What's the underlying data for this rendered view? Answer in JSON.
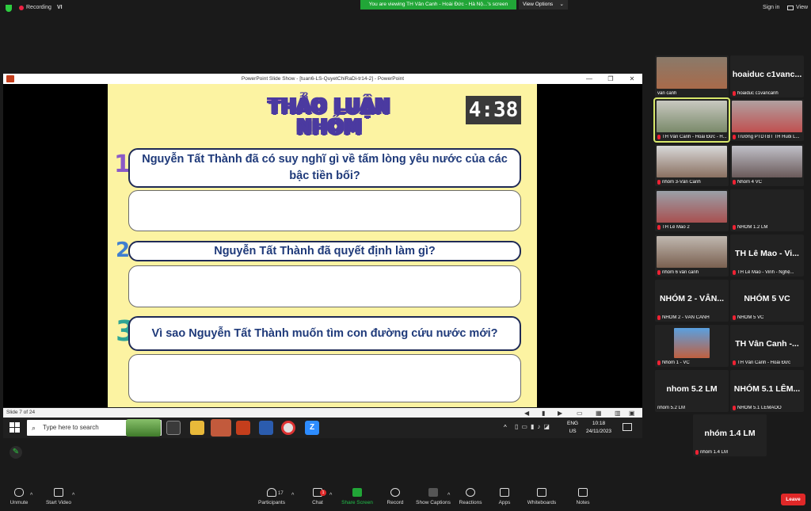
{
  "topbar": {
    "recording_label": "Recording",
    "language": "VI",
    "banner": "You are viewing TH Vân Canh - Hoài Đức - Hà Nộ...'s screen",
    "view_options": "View Options",
    "sign_in": "Sign in",
    "view": "View"
  },
  "ppt": {
    "window_title": "PowerPoint Slide Show - [tuan6-LS-QuyetChiRaDi-tr14-2] - PowerPoint",
    "status": "Slide 7 of 24",
    "slide": {
      "title": "THẢO LUẬN NHÓM",
      "timer": "4:38",
      "questions": [
        {
          "num": "1",
          "text": "Nguyễn Tất Thành đã có suy nghĩ gì về tấm lòng yêu nước của các bậc tiền bối?"
        },
        {
          "num": "2",
          "text": "Nguyễn Tất Thành đã quyết định làm gì?"
        },
        {
          "num": "3",
          "text": "Vì sao Nguyễn Tất Thành muốn tìm con đường cứu nước mới?"
        }
      ]
    }
  },
  "taskbar": {
    "search_placeholder": "Type here to search",
    "lang_line1": "ENG",
    "lang_line2": "US",
    "time": "10:18",
    "date": "24/11/2023"
  },
  "participants": [
    {
      "label": "van canh",
      "big": "",
      "has_video": true
    },
    {
      "label": "hoaiduc c1vancanh",
      "big": "hoaiduc c1vanc...",
      "has_video": false
    },
    {
      "label": "TH Vân Canh - Hoài Đức - H...",
      "big": "",
      "has_video": true
    },
    {
      "label": "Trường PTDTBT TH Huổi L...",
      "big": "",
      "has_video": true
    },
    {
      "label": "nhóm 3-Vân Canh",
      "big": "",
      "has_video": true
    },
    {
      "label": "Nhóm 4 VC",
      "big": "",
      "has_video": true
    },
    {
      "label": "TH Lê Mao 2",
      "big": "",
      "has_video": true
    },
    {
      "label": "NHÓM 1.2 LM",
      "big": "",
      "has_video": false
    },
    {
      "label": "nhóm 6 vân canh",
      "big": "",
      "has_video": true
    },
    {
      "label": "TH Lê Mao - Vinh - Nghệ...",
      "big": "TH Lê Mao - Vi...",
      "has_video": false
    },
    {
      "label": "NHÓM 2 - VÂN CANH",
      "big": "NHÓM 2 - VÂN...",
      "has_video": false
    },
    {
      "label": "NHÓM 5 VC",
      "big": "NHÓM 5 VC",
      "has_video": false
    },
    {
      "label": "Nhóm 1 - VC",
      "big": "",
      "has_video": true
    },
    {
      "label": "TH Vân Canh - Hoài Đức",
      "big": "TH Vân Canh -...",
      "has_video": false
    },
    {
      "label": "nhóm 5.2 LM",
      "big": "nhom 5.2 LM",
      "has_video": false
    },
    {
      "label": "NHÓM 5.1 LÊMAOO",
      "big": "NHÓM 5.1 LÊM...",
      "has_video": false
    },
    {
      "label": "nhóm 1.4 LM",
      "big": "nhóm 1.4 LM",
      "has_video": false
    }
  ],
  "toolbar": {
    "unmute": "Unmute",
    "start_video": "Start Video",
    "participants": "Participants",
    "participants_count": "17",
    "chat": "Chat",
    "chat_badge": "1",
    "share_screen": "Share Screen",
    "record": "Record",
    "show_captions": "Show Captions",
    "reactions": "Reactions",
    "apps": "Apps",
    "whiteboards": "Whiteboards",
    "notes": "Notes",
    "leave": "Leave"
  },
  "colors": {
    "slide_bg": "#fcf3a2",
    "question_text": "#1f3a7a",
    "leave": "#e02828",
    "share": "#21a637"
  }
}
